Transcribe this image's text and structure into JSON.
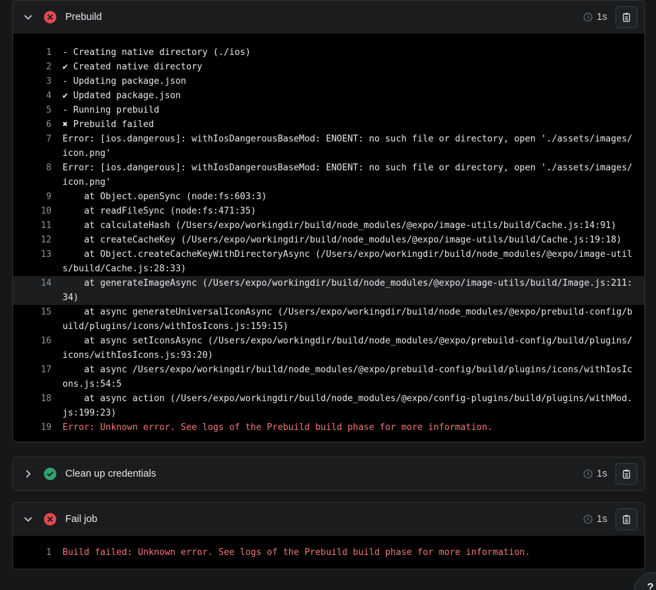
{
  "colors": {
    "error": "#e5484d",
    "success": "#30a46c",
    "error_text": "#f27777",
    "background": "#151718",
    "log_background": "#000000"
  },
  "phases": [
    {
      "title": "Prebuild",
      "status": "error",
      "status_icon": "error-x-circle-icon",
      "expanded": true,
      "chevron_icon": "chevron-down-icon",
      "duration": "1s",
      "copy_icon": "clipboard-icon",
      "lines": [
        {
          "n": "1",
          "text": "- Creating native directory (./ios)"
        },
        {
          "n": "2",
          "text": "✔ Created native directory"
        },
        {
          "n": "3",
          "text": "- Updating package.json"
        },
        {
          "n": "4",
          "text": "✔ Updated package.json"
        },
        {
          "n": "5",
          "text": "- Running prebuild"
        },
        {
          "n": "6",
          "text": "✖ Prebuild failed"
        },
        {
          "n": "7",
          "text": "Error: [ios.dangerous]: withIosDangerousBaseMod: ENOENT: no such file or directory, open './assets/images/icon.png'"
        },
        {
          "n": "8",
          "text": "Error: [ios.dangerous]: withIosDangerousBaseMod: ENOENT: no such file or directory, open './assets/images/icon.png'"
        },
        {
          "n": "9",
          "text": "    at Object.openSync (node:fs:603:3)"
        },
        {
          "n": "10",
          "text": "    at readFileSync (node:fs:471:35)"
        },
        {
          "n": "11",
          "text": "    at calculateHash (/Users/expo/workingdir/build/node_modules/@expo/image-utils/build/Cache.js:14:91)"
        },
        {
          "n": "12",
          "text": "    at createCacheKey (/Users/expo/workingdir/build/node_modules/@expo/image-utils/build/Cache.js:19:18)"
        },
        {
          "n": "13",
          "text": "    at Object.createCacheKeyWithDirectoryAsync (/Users/expo/workingdir/build/node_modules/@expo/image-utils/build/Cache.js:28:33)"
        },
        {
          "n": "14",
          "text": "    at generateImageAsync (/Users/expo/workingdir/build/node_modules/@expo/image-utils/build/Image.js:211:34)",
          "highlight": true
        },
        {
          "n": "15",
          "text": "    at async generateUniversalIconAsync (/Users/expo/workingdir/build/node_modules/@expo/prebuild-config/build/plugins/icons/withIosIcons.js:159:15)"
        },
        {
          "n": "16",
          "text": "    at async setIconsAsync (/Users/expo/workingdir/build/node_modules/@expo/prebuild-config/build/plugins/icons/withIosIcons.js:93:20)"
        },
        {
          "n": "17",
          "text": "    at async /Users/expo/workingdir/build/node_modules/@expo/prebuild-config/build/plugins/icons/withIosIcons.js:54:5"
        },
        {
          "n": "18",
          "text": "    at async action (/Users/expo/workingdir/build/node_modules/@expo/config-plugins/build/plugins/withMod.js:199:23)"
        },
        {
          "n": "19",
          "text": "Error: Unknown error. See logs of the Prebuild build phase for more information.",
          "error": true
        }
      ]
    },
    {
      "title": "Clean up credentials",
      "status": "success",
      "status_icon": "success-check-circle-icon",
      "expanded": false,
      "chevron_icon": "chevron-right-icon",
      "duration": "1s",
      "copy_icon": "clipboard-icon",
      "lines": []
    },
    {
      "title": "Fail job",
      "status": "error",
      "status_icon": "error-x-circle-icon",
      "expanded": true,
      "chevron_icon": "chevron-down-icon",
      "duration": "1s",
      "copy_icon": "clipboard-icon",
      "lines": [
        {
          "n": "1",
          "text": "Build failed: Unknown error. See logs of the Prebuild build phase for more information.",
          "error": true
        }
      ]
    }
  ],
  "help_button": {
    "label": "?",
    "icon": "help-icon"
  }
}
